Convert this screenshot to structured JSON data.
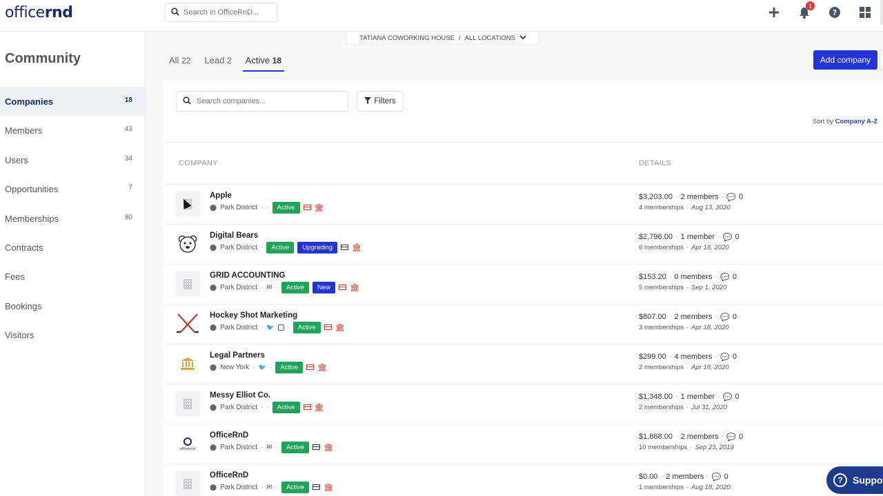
{
  "header": {
    "logo_regular": "office",
    "logo_bold": "rnd",
    "search_placeholder": "Search in OfficeRnD...",
    "notification_count": "1",
    "icons": [
      "plus-icon",
      "bell-icon",
      "help-icon",
      "apps-grid-icon"
    ]
  },
  "location": {
    "coworking": "TATIANA COWORKING HOUSE",
    "separator": "/",
    "scope": "ALL LOCATIONS"
  },
  "sidebar": {
    "title": "Community",
    "items": [
      {
        "label": "Companies",
        "count": "18",
        "active": true
      },
      {
        "label": "Members",
        "count": "43"
      },
      {
        "label": "Users",
        "count": "34"
      },
      {
        "label": "Opportunities",
        "count": "7"
      },
      {
        "label": "Memberships",
        "count": "80"
      },
      {
        "label": "Contracts",
        "count": ""
      },
      {
        "label": "Fees",
        "count": ""
      },
      {
        "label": "Bookings",
        "count": ""
      },
      {
        "label": "Visitors",
        "count": ""
      }
    ]
  },
  "tabs": [
    {
      "label": "All",
      "count": "22"
    },
    {
      "label": "Lead",
      "count": "2"
    },
    {
      "label": "Active",
      "count": "18",
      "active": true
    }
  ],
  "toolbar": {
    "add_company": "Add company",
    "search_placeholder": "Search companies...",
    "filters": "Filters",
    "sort_prefix": "Sort by",
    "sort_value": "Company A-Z"
  },
  "columns": {
    "company": "COMPANY",
    "details": "DETAILS"
  },
  "companies": [
    {
      "name": "Apple",
      "location": "Park District",
      "badges": [
        "Active"
      ],
      "amount": "$3,203.00",
      "members": "2 members",
      "comments": "0",
      "memberships": "4 memberships",
      "date": "Aug 13, 2020"
    },
    {
      "name": "Digital Bears",
      "location": "Park District",
      "badges": [
        "Active",
        "Upgrading"
      ],
      "amount": "$2,796.00",
      "members": "1 member",
      "comments": "0",
      "memberships": "6 memberships",
      "date": "Apr 18, 2020"
    },
    {
      "name": "GRID ACCOUNTING",
      "location": "Park District",
      "badges": [
        "Active",
        "New"
      ],
      "amount": "$153.20",
      "members": "0 members",
      "comments": "0",
      "memberships": "5 memberships",
      "date": "Sep 1, 2020"
    },
    {
      "name": "Hockey Shot Marketing",
      "location": "Park District",
      "badges": [
        "Active"
      ],
      "amount": "$807.00",
      "members": "2 members",
      "comments": "0",
      "memberships": "3 memberships",
      "date": "Apr 18, 2020"
    },
    {
      "name": "Legal Partners",
      "location": "New York",
      "badges": [
        "Active"
      ],
      "amount": "$299.00",
      "members": "4 members",
      "comments": "0",
      "memberships": "2 memberships",
      "date": "Apr 18, 2020"
    },
    {
      "name": "Messy Elliot Co.",
      "location": "Park District",
      "badges": [
        "Active"
      ],
      "amount": "$1,348.00",
      "members": "1 member",
      "comments": "0",
      "memberships": "2 memberships",
      "date": "Jul 31, 2020"
    },
    {
      "name": "OfficeRnD",
      "location": "Park District",
      "badges": [
        "Active"
      ],
      "amount": "$1,868.00",
      "members": "2 members",
      "comments": "0",
      "memberships": "10 memberships",
      "date": "Sep 23, 2019"
    },
    {
      "name": "OfficeRnD",
      "location": "Park District",
      "badges": [
        "Active"
      ],
      "amount": "$0.00",
      "members": "2 members",
      "comments": "0",
      "memberships": "1 memberships",
      "date": "Aug 18, 2020"
    }
  ],
  "support": {
    "label": "Suppo"
  }
}
